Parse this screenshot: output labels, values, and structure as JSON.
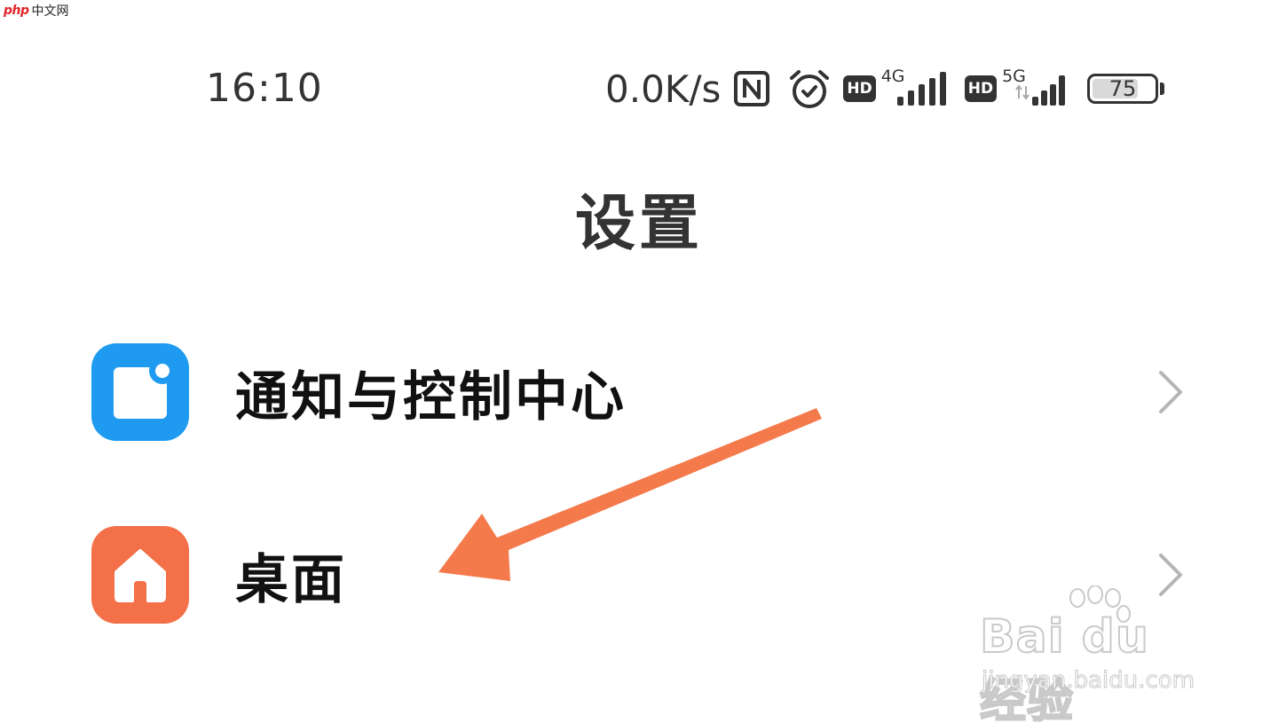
{
  "watermark_top": {
    "logo_text": "php",
    "site_text": "中文网"
  },
  "status_bar": {
    "time": "16:10",
    "net_speed": "0.0K/s",
    "hd_label_1": "HD",
    "network_1": "4G",
    "hd_label_2": "HD",
    "network_2": "5G",
    "battery_level": "75",
    "battery_fraction": 0.75,
    "icons": [
      "nfc-icon",
      "alarm-icon",
      "signal-4g-icon",
      "signal-5g-icon",
      "battery-icon"
    ]
  },
  "header": {
    "title": "设置"
  },
  "settings": {
    "items": [
      {
        "label": "通知与控制中心",
        "icon": "notification-icon",
        "icon_color": "#1e9bf0"
      },
      {
        "label": "桌面",
        "icon": "home-icon",
        "icon_color": "#f37048"
      }
    ]
  },
  "annotation": {
    "arrow_color": "#f47a4c",
    "points_to": "桌面"
  },
  "watermark_bottom": {
    "brand": "Bai du 经验",
    "url": "jingyan.baidu.com"
  }
}
